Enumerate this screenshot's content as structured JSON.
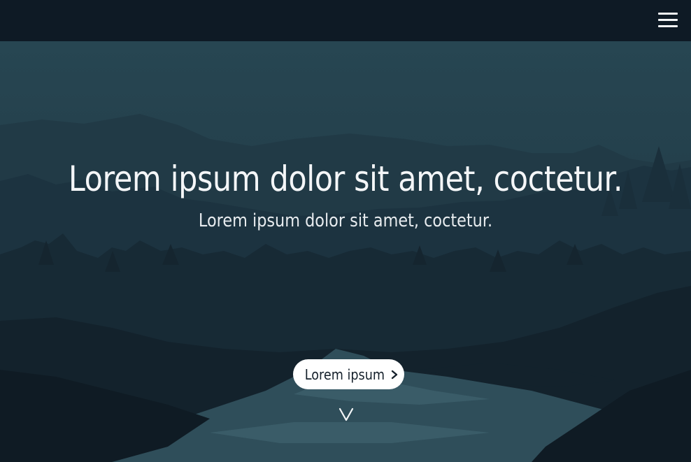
{
  "menu": {
    "icon": "hamburger-menu-icon"
  },
  "hero": {
    "title": "Lorem ipsum dolor sit amet, coctetur.",
    "subtitle": "Lorem ipsum dolor sit amet, coctetur.",
    "cta_label": "Lorem ipsum",
    "cta_icon": "chevron-right-icon",
    "scroll_icon": "chevron-down-icon"
  },
  "colors": {
    "topbar": "#0e1a25",
    "sky": "#24414d",
    "text": "#f4f6f8",
    "button_bg": "#ffffff"
  }
}
